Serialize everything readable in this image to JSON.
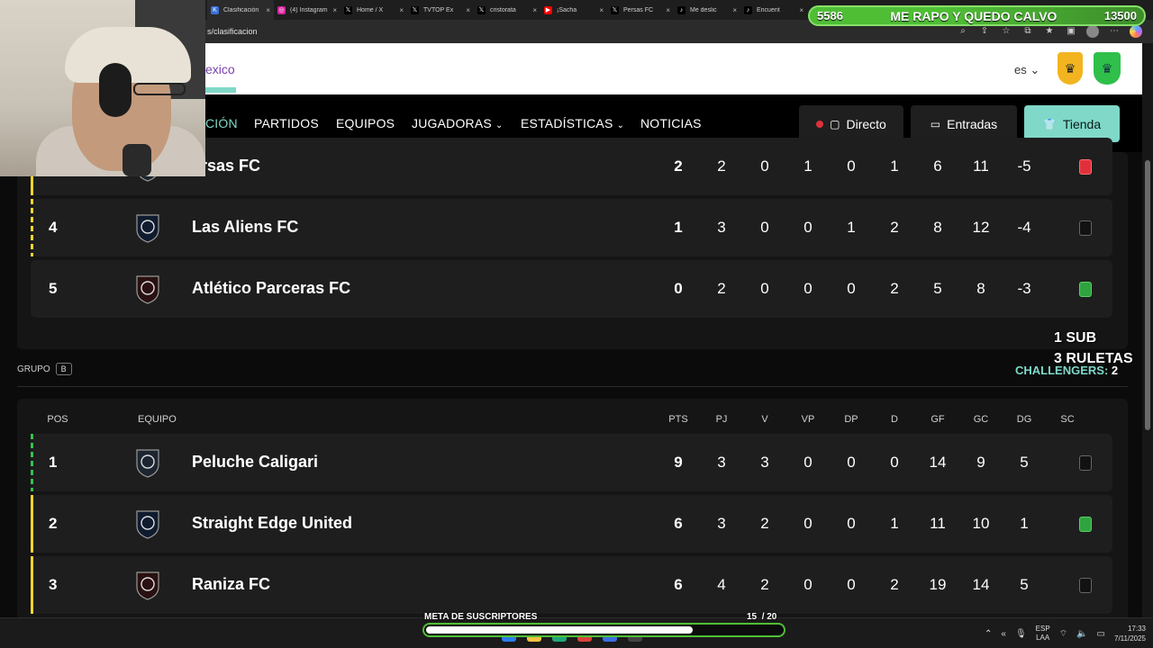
{
  "browser": {
    "tabs": [
      {
        "title": "Clasificación",
        "icon": "kings-league-icon",
        "color": "#3a6fd8",
        "glyph": "K",
        "active": true
      },
      {
        "title": "(4) Instagram",
        "icon": "instagram-icon",
        "color": "#d6249f",
        "glyph": "◎"
      },
      {
        "title": "Home / X",
        "icon": "x-icon",
        "color": "#000000",
        "glyph": "𝕏"
      },
      {
        "title": "TVTOP Ex",
        "icon": "x-icon",
        "color": "#000000",
        "glyph": "𝕏"
      },
      {
        "title": "cristorata",
        "icon": "x-icon",
        "color": "#000000",
        "glyph": "𝕏"
      },
      {
        "title": "¡Sacha",
        "icon": "youtube-icon",
        "color": "#ff0000",
        "glyph": "▶"
      },
      {
        "title": "Persas FC",
        "icon": "x-icon",
        "color": "#000000",
        "glyph": "𝕏"
      },
      {
        "title": "Me deslic",
        "icon": "tiktok-icon",
        "color": "#000000",
        "glyph": "♪"
      },
      {
        "title": "Encuent",
        "icon": "tiktok-icon",
        "color": "#000000",
        "glyph": "♪"
      }
    ],
    "url": "s/clasificacion"
  },
  "overlay": {
    "left_count": "5586",
    "title": "ME RAPO Y QUEDO CALVO",
    "right_count": "13500"
  },
  "site": {
    "brand_partial": "exico",
    "language": "es",
    "nav": {
      "active_partial": "CIÓN",
      "partidos": "PARTIDOS",
      "equipos": "EQUIPOS",
      "jugadoras": "JUGADORAS",
      "estadisticas": "ESTADÍSTICAS",
      "noticias": "NOTICIAS"
    },
    "buttons": {
      "directo": "Directo",
      "entradas": "Entradas",
      "tienda": "Tienda"
    }
  },
  "group_a_rows": [
    {
      "pos": "",
      "team": "ersas FC",
      "stats": [
        "2",
        "2",
        "0",
        "1",
        "0",
        "1",
        "6",
        "11",
        "-5"
      ],
      "sc": "red",
      "stripe": "yellow-solid"
    },
    {
      "pos": "4",
      "team": "Las Aliens FC",
      "stats": [
        "1",
        "3",
        "0",
        "0",
        "1",
        "2",
        "8",
        "12",
        "-4"
      ],
      "sc": "black",
      "stripe": "yellow"
    },
    {
      "pos": "5",
      "team": "Atlético Parceras FC",
      "stats": [
        "0",
        "2",
        "0",
        "0",
        "0",
        "2",
        "5",
        "8",
        "-3"
      ],
      "sc": "green",
      "stripe": ""
    }
  ],
  "group_b": {
    "label": "GRUPO",
    "badge": "B",
    "headers": {
      "pos": "POS",
      "equipo": "EQUIPO",
      "stats": [
        "PTS",
        "PJ",
        "V",
        "VP",
        "DP",
        "D",
        "GF",
        "GC",
        "DG",
        "SC"
      ]
    },
    "rows": [
      {
        "pos": "1",
        "team": "Peluche Caligari",
        "stats": [
          "9",
          "3",
          "3",
          "0",
          "0",
          "0",
          "14",
          "9",
          "5"
        ],
        "sc": "black",
        "stripe": "green"
      },
      {
        "pos": "2",
        "team": "Straight Edge United",
        "stats": [
          "6",
          "3",
          "2",
          "0",
          "0",
          "1",
          "11",
          "10",
          "1"
        ],
        "sc": "green",
        "stripe": "yellow-solid"
      },
      {
        "pos": "3",
        "team": "Raniza FC",
        "stats": [
          "6",
          "4",
          "2",
          "0",
          "0",
          "2",
          "19",
          "14",
          "5"
        ],
        "sc": "black",
        "stripe": "yellow-solid"
      }
    ]
  },
  "stream_overlay": {
    "sub": "1 SUB",
    "ruletas": "3 RULETAS",
    "challengers_label": "CHALLENGERS:",
    "challengers_value": "2"
  },
  "subscriber_goal": {
    "title": "META DE SUSCRIPTORES",
    "current": 15,
    "separator": "/",
    "goal": 20
  },
  "taskbar": {
    "lang_top": "ESP",
    "lang_bottom": "LAA",
    "time": "17:33",
    "date": "7/11/2025"
  },
  "colors": {
    "accent": "#7fd8c8",
    "overlay_green": "#4fbe35",
    "sc_red": "#e0313b",
    "sc_green": "#2fa33e"
  }
}
